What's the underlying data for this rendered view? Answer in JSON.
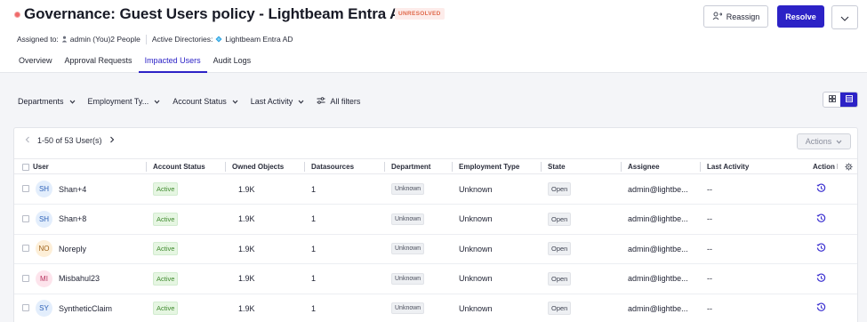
{
  "header": {
    "title": "Governance: Guest Users policy - Lightbeam Entra AD",
    "status_badge": "UNRESOLVED",
    "reassign_label": "Reassign",
    "resolve_label": "Resolve",
    "assigned_to_label": "Assigned to:",
    "assignees": "admin (You)2 People",
    "active_directories_label": "Active Directories:",
    "active_directory": "Lightbeam Entra AD"
  },
  "tabs": [
    {
      "label": "Overview",
      "active": false
    },
    {
      "label": "Approval Requests",
      "active": false
    },
    {
      "label": "Impacted Users",
      "active": true
    },
    {
      "label": "Audit Logs",
      "active": false
    }
  ],
  "filters": {
    "departments": "Departments",
    "employment_type": "Employment Ty...",
    "account_status": "Account Status",
    "last_activity": "Last Activity",
    "all_filters": "All filters"
  },
  "table": {
    "pagination": "1-50 of 53 User(s)",
    "actions_label": "Actions",
    "columns": {
      "user": "User",
      "account_status": "Account Status",
      "owned_objects": "Owned Objects",
      "datasources": "Datasources",
      "department": "Department",
      "employment_type": "Employment Type",
      "state": "State",
      "assignee": "Assignee",
      "last_activity": "Last Activity",
      "action": "Action h"
    },
    "rows": [
      {
        "initials": "SH",
        "name": "Shan+4",
        "avatar_bg": "#e3eefc",
        "avatar_fg": "#2f62b8",
        "account_status": "Active",
        "owned_objects": "1.9K",
        "datasources": "1",
        "department": "Unknown",
        "employment_type": "Unknown",
        "state": "Open",
        "assignee": "admin@lightbe...",
        "last_activity": "--"
      },
      {
        "initials": "SH",
        "name": "Shan+8",
        "avatar_bg": "#e3eefc",
        "avatar_fg": "#2f62b8",
        "account_status": "Active",
        "owned_objects": "1.9K",
        "datasources": "1",
        "department": "Unknown",
        "employment_type": "Unknown",
        "state": "Open",
        "assignee": "admin@lightbe...",
        "last_activity": "--"
      },
      {
        "initials": "NO",
        "name": "Noreply",
        "avatar_bg": "#fdefd8",
        "avatar_fg": "#a0641c",
        "account_status": "Active",
        "owned_objects": "1.9K",
        "datasources": "1",
        "department": "Unknown",
        "employment_type": "Unknown",
        "state": "Open",
        "assignee": "admin@lightbe...",
        "last_activity": "--"
      },
      {
        "initials": "MI",
        "name": "Misbahul23",
        "avatar_bg": "#fde4ec",
        "avatar_fg": "#b8325e",
        "account_status": "Active",
        "owned_objects": "1.9K",
        "datasources": "1",
        "department": "Unknown",
        "employment_type": "Unknown",
        "state": "Open",
        "assignee": "admin@lightbe...",
        "last_activity": "--"
      },
      {
        "initials": "SY",
        "name": "SyntheticClaim",
        "avatar_bg": "#e3eefc",
        "avatar_fg": "#2f62b8",
        "account_status": "Active",
        "owned_objects": "1.9K",
        "datasources": "1",
        "department": "Unknown",
        "employment_type": "Unknown",
        "state": "Open",
        "assignee": "admin@lightbe...",
        "last_activity": "--"
      }
    ]
  },
  "colors": {
    "primary": "#2c22c6",
    "status_dot": "#f06a6a",
    "unresolved_text": "#e06a4c",
    "active_pill_bg": "#e6f6e2",
    "active_pill_text": "#3f8a2e"
  },
  "icons": {
    "reassign": "user-swap-icon",
    "more": "chevron-down-icon",
    "assignee": "person-icon",
    "directory": "diamond-icon",
    "all_filters": "sliders-icon",
    "grid_view": "grid-icon",
    "list_view": "list-icon",
    "prev_page": "chevron-left-icon",
    "next_page": "chevron-right-icon",
    "settings": "gear-icon",
    "row_action": "clock-history-icon"
  }
}
